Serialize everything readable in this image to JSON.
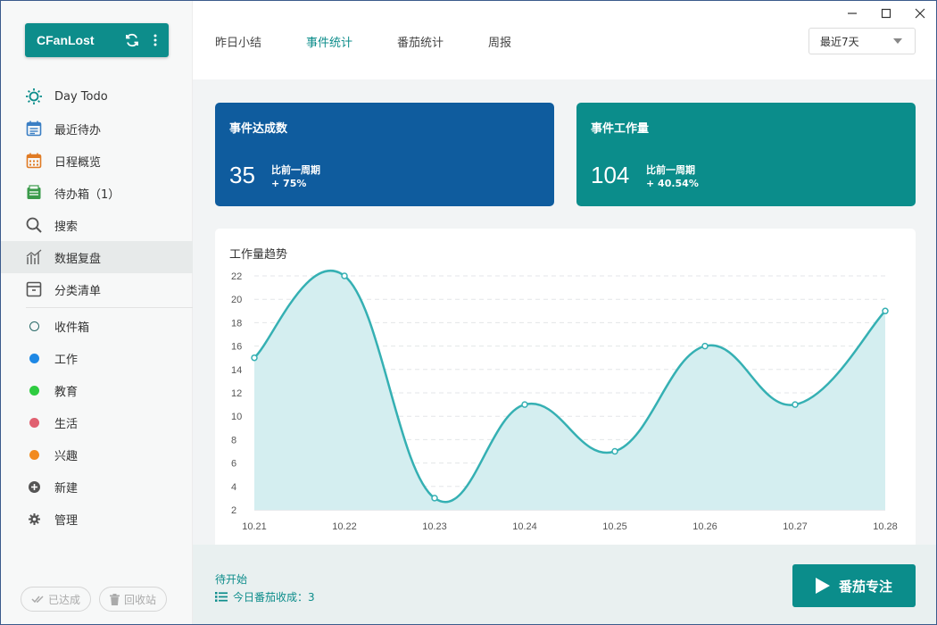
{
  "user": {
    "name": "CFanLost"
  },
  "nav": [
    {
      "label": "Day Todo",
      "icon": "sun-icon",
      "color": "#0d8d8b"
    },
    {
      "label": "最近待办",
      "icon": "calendar-list-icon",
      "color": "#3b7fc4"
    },
    {
      "label": "日程概览",
      "icon": "calendar-grid-icon",
      "color": "#e07b24"
    },
    {
      "label": "待办箱（1）",
      "icon": "inbox-tray-icon",
      "color": "#3a9a4a"
    },
    {
      "label": "搜索",
      "icon": "search-icon",
      "color": "#555555"
    },
    {
      "label": "数据复盘",
      "icon": "chart-bars-icon",
      "color": "#666666",
      "active": true
    },
    {
      "label": "分类清单",
      "icon": "archive-box-icon",
      "color": "#555555"
    }
  ],
  "categories": [
    {
      "label": "收件箱",
      "color": "#2a6a68",
      "hollow": true
    },
    {
      "label": "工作",
      "color": "#1e88e5"
    },
    {
      "label": "教育",
      "color": "#2ecc40"
    },
    {
      "label": "生活",
      "color": "#e06070"
    },
    {
      "label": "兴趣",
      "color": "#f28a1e"
    }
  ],
  "actions": [
    {
      "label": "新建",
      "icon": "plus-circle-icon"
    },
    {
      "label": "管理",
      "icon": "gear-icon"
    }
  ],
  "bottom": {
    "done_label": "已达成",
    "trash_label": "回收站"
  },
  "tabs": [
    {
      "label": "昨日小结"
    },
    {
      "label": "事件统计",
      "active": true
    },
    {
      "label": "番茄统计"
    },
    {
      "label": "周报"
    }
  ],
  "range_select": {
    "value": "最近7天"
  },
  "cards": [
    {
      "title": "事件达成数",
      "value": "35",
      "cmp_label": "比前一周期",
      "cmp_value": "+ 75%",
      "color": "#0f5c9e"
    },
    {
      "title": "事件工作量",
      "value": "104",
      "cmp_label": "比前一周期",
      "cmp_value": "+ 40.54%",
      "color": "#0b8d8b"
    }
  ],
  "chart_data": {
    "type": "area",
    "title": "工作量趋势",
    "categories": [
      "10.21",
      "10.22",
      "10.23",
      "10.24",
      "10.25",
      "10.26",
      "10.27",
      "10.28"
    ],
    "values": [
      15,
      22,
      3,
      11,
      7,
      16,
      11,
      19
    ],
    "ylim": [
      2,
      22
    ],
    "yticks": [
      2,
      4,
      6,
      8,
      10,
      12,
      14,
      16,
      18,
      20,
      22
    ],
    "grid": true,
    "line_color": "#35b0b3",
    "fill_color": "#d4eef0"
  },
  "footer": {
    "status": "待开始",
    "count_label": "今日番茄收成：3",
    "focus_label": "番茄专注"
  }
}
